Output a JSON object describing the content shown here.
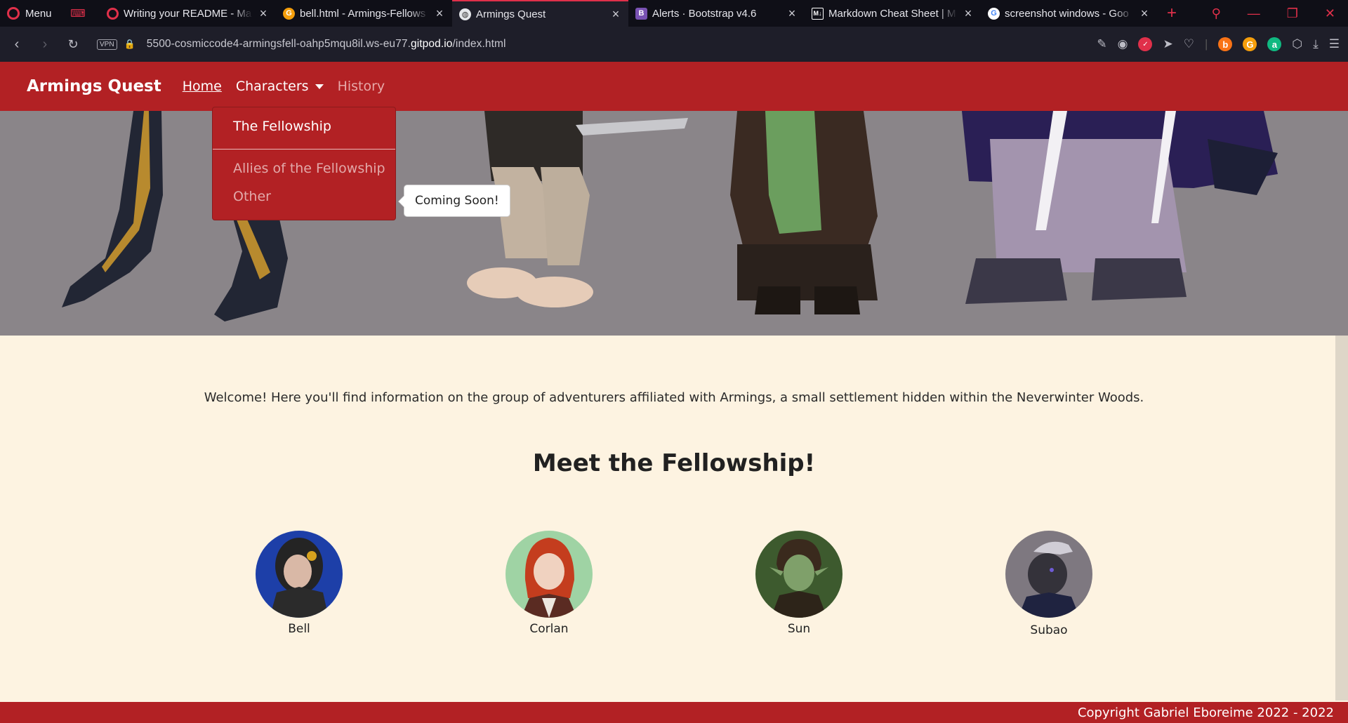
{
  "browser": {
    "menu_label": "Menu",
    "tabs": [
      {
        "title": "Writing your README - Ma",
        "icon": "opera-icon",
        "color": "#e0304a"
      },
      {
        "title": "bell.html - Armings-Fellows",
        "icon": "gitpod-icon",
        "color": "#f59e0b"
      },
      {
        "title": "Armings Quest",
        "icon": "globe-icon",
        "color": "#9ca3af"
      },
      {
        "title": "Alerts · Bootstrap v4.6",
        "icon": "bootstrap-icon",
        "color": "#7952b3"
      },
      {
        "title": "Markdown Cheat Sheet | M",
        "icon": "markdown-icon",
        "color": "#ffffff"
      },
      {
        "title": "screenshot windows - Goo",
        "icon": "google-icon",
        "color": "#4285f4"
      }
    ],
    "active_tab_index": 2,
    "vpn_label": "VPN",
    "url_prefix": "5500-cosmiccode4-armingsfell-oahp5mqu8il.ws-eu77.",
    "url_domain": "gitpod.io",
    "url_suffix": "/index.html"
  },
  "navbar": {
    "brand": "Armings Quest",
    "home": "Home",
    "characters": "Characters",
    "history": "History",
    "accent_color": "#b22124"
  },
  "dropdown": {
    "items": [
      "The Fellowship",
      "Allies of the Fellowship",
      "Other"
    ]
  },
  "tooltip": "Coming Soon!",
  "main": {
    "welcome": "Welcome! Here you'll find information on the group of adventurers affiliated with Armings, a small settlement hidden within the Neverwinter Woods.",
    "section_title": "Meet the Fellowship!",
    "members": [
      {
        "name": "Bell"
      },
      {
        "name": "Corlan"
      },
      {
        "name": "Sun"
      },
      {
        "name": "Subao"
      }
    ]
  },
  "footer": {
    "copyright": "Copyright Gabriel Eboreime 2022 - 2022"
  }
}
